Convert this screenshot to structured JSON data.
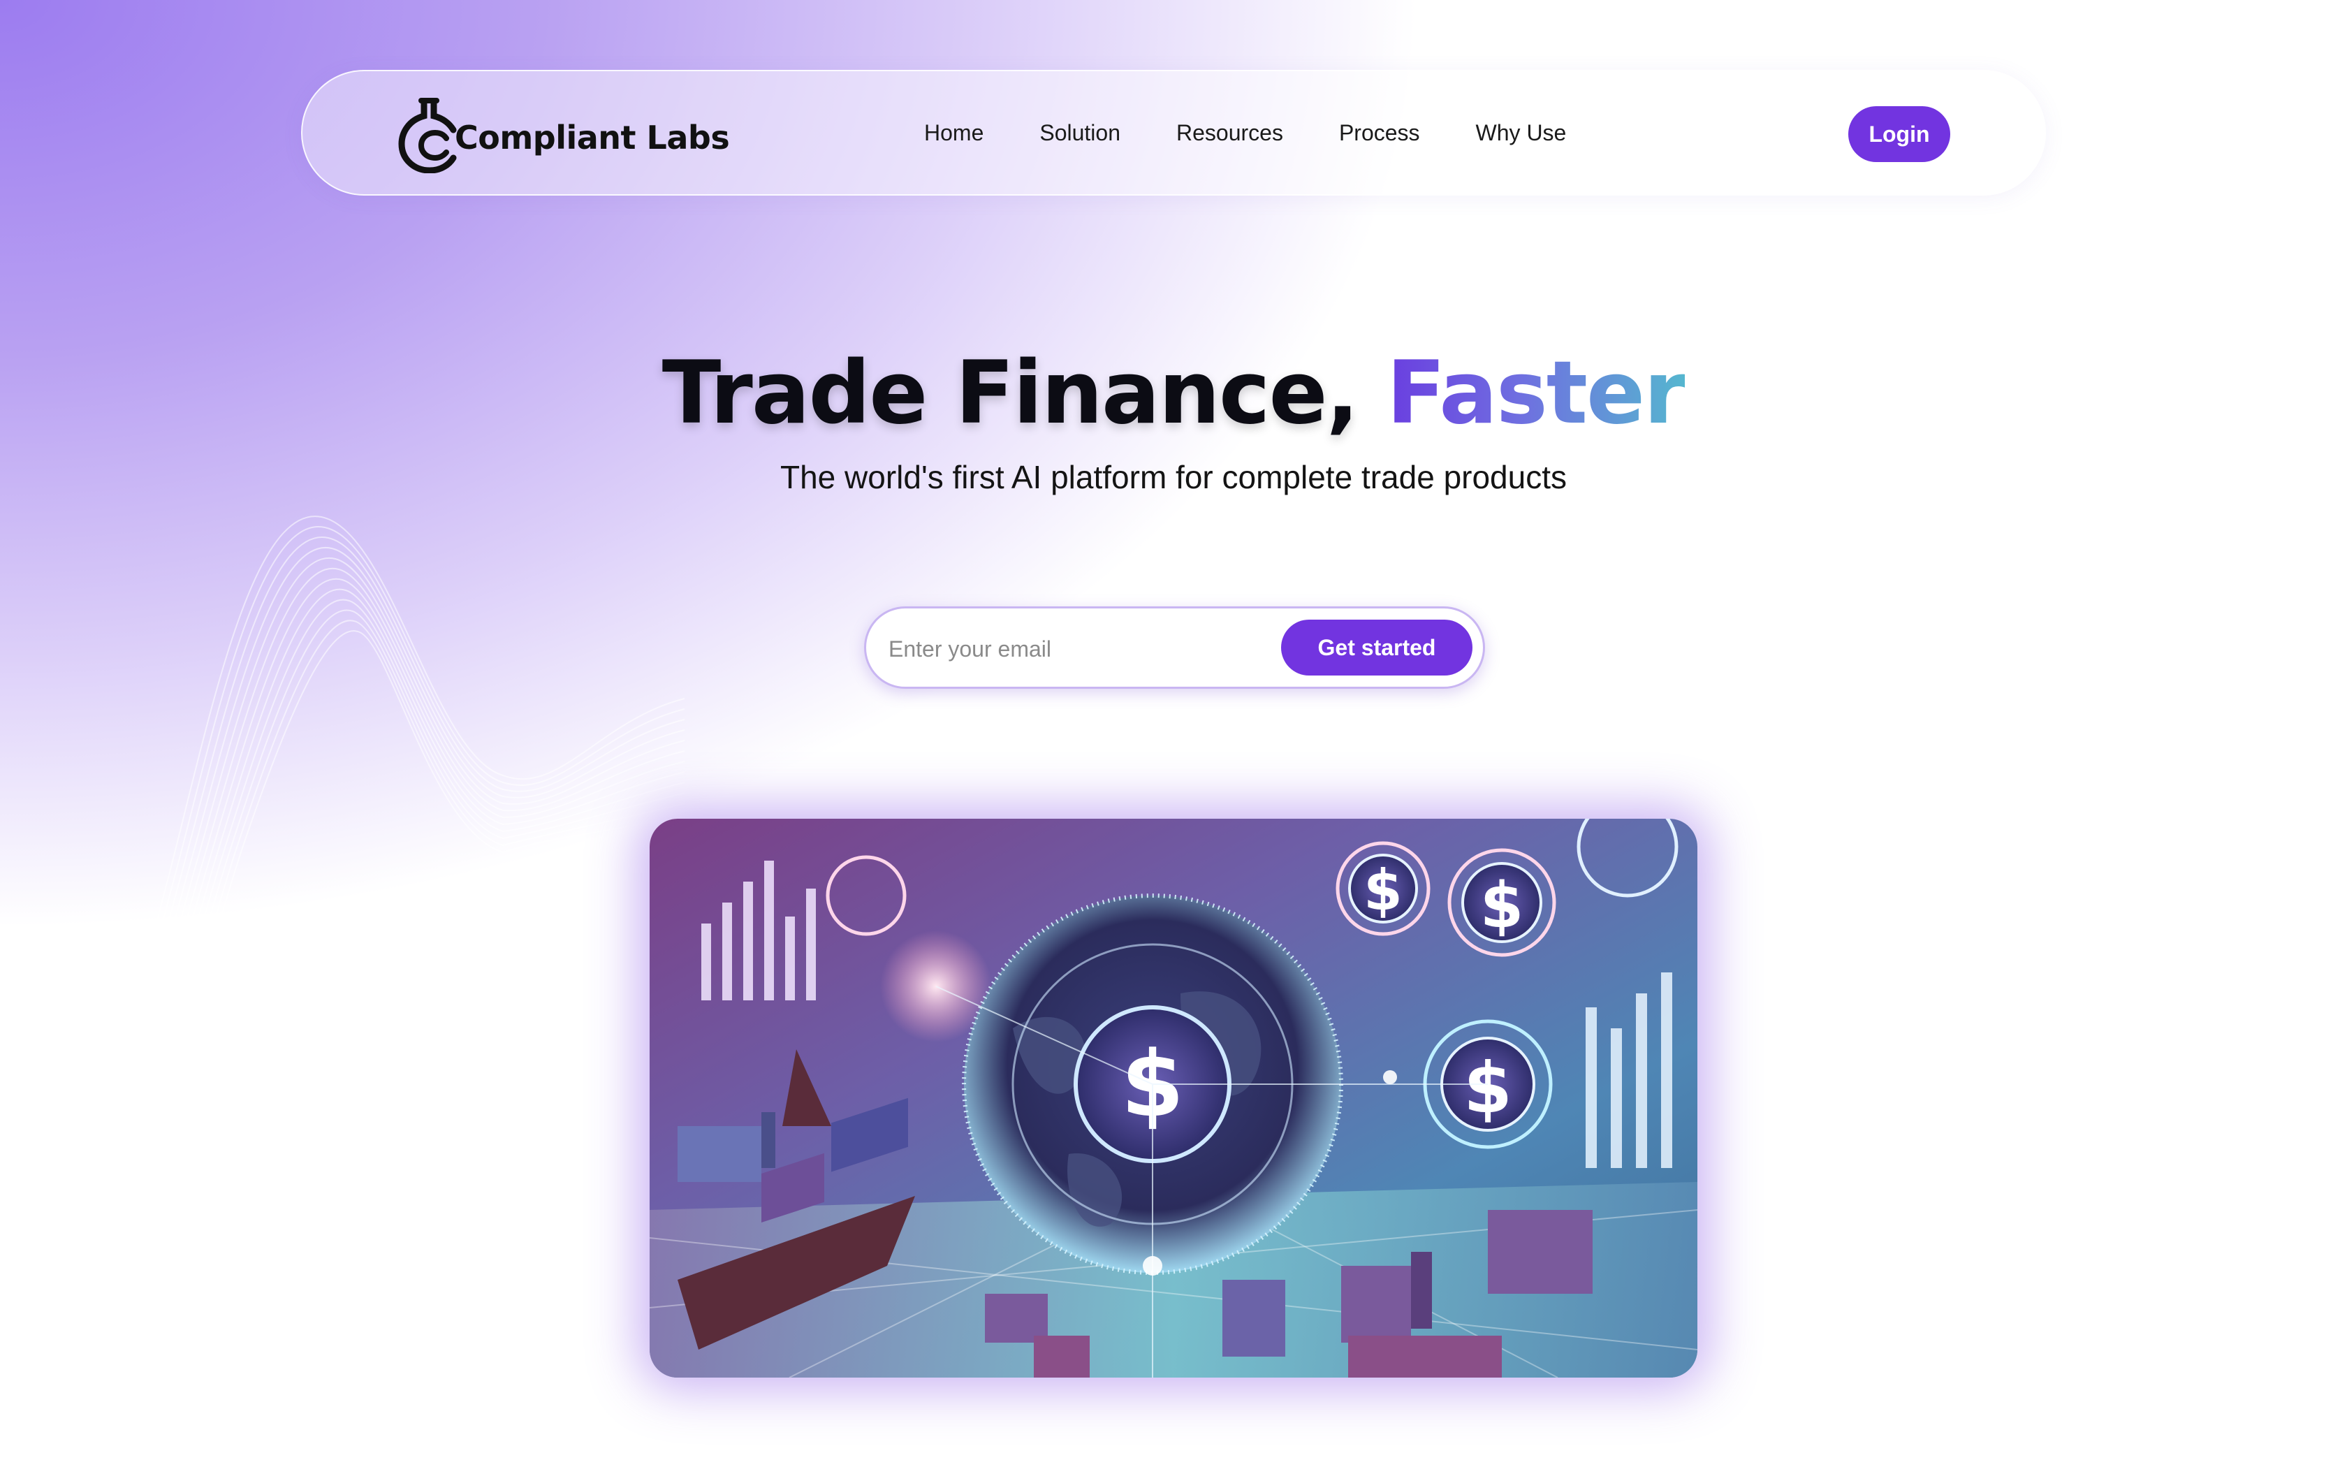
{
  "brand": {
    "name": "Compliant Labs",
    "accent_color": "#7234e0"
  },
  "nav": {
    "links": [
      "Home",
      "Solution",
      "Resources",
      "Process",
      "Why Use"
    ],
    "login_label": "Login"
  },
  "hero": {
    "title_main": "Trade Finance, ",
    "title_accent": "Faster",
    "subtitle": "The world's first AI platform for complete trade products",
    "email_placeholder": "Enter your email",
    "cta_label": "Get started"
  },
  "hero_image": {
    "depicts": [
      "globe",
      "dollar-coin",
      "container-ship",
      "shipping-container",
      "bar-chart"
    ]
  }
}
